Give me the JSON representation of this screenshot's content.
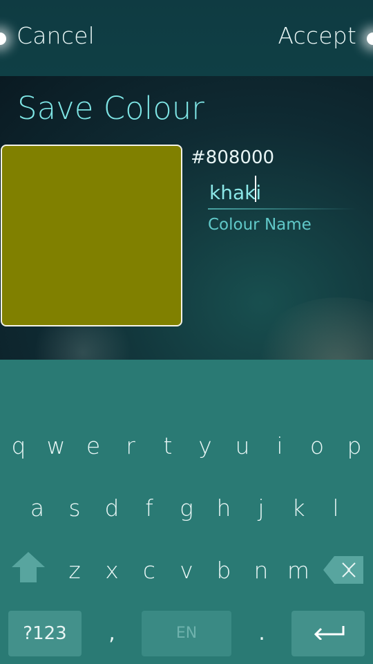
{
  "header": {
    "cancel_label": "Cancel",
    "accept_label": "Accept"
  },
  "dialog": {
    "title": "Save Colour",
    "swatch_color": "#808000",
    "hex_value": "#808000",
    "name_value": "khaki",
    "name_label": "Colour Name"
  },
  "keyboard": {
    "row1": [
      "q",
      "w",
      "e",
      "r",
      "t",
      "y",
      "u",
      "i",
      "o",
      "p"
    ],
    "row2": [
      "a",
      "s",
      "d",
      "f",
      "g",
      "h",
      "j",
      "k",
      "l"
    ],
    "row3": [
      "z",
      "x",
      "c",
      "v",
      "b",
      "n",
      "m"
    ],
    "symbols_label": "?123",
    "comma_label": ",",
    "space_label": "EN",
    "period_label": ".",
    "shift_icon": "shift-arrow-icon",
    "backspace_icon": "backspace-icon",
    "enter_icon": "enter-icon"
  },
  "colors": {
    "accent": "#7fe6e6",
    "keyboard_bg": "#2a7a74"
  }
}
